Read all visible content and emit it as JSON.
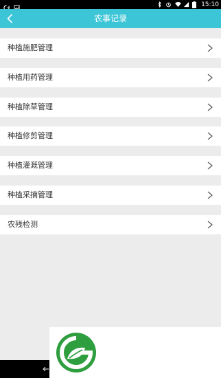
{
  "status_bar": {
    "time": "15:10"
  },
  "header": {
    "title": "农事记录",
    "color": "#3cc5d6"
  },
  "menu": {
    "items": [
      {
        "label": "种植施肥管理",
        "icon": "chevron-right-icon"
      },
      {
        "label": "种植用药管理",
        "icon": "chevron-right-icon"
      },
      {
        "label": "种植除草管理",
        "icon": "chevron-right-icon"
      },
      {
        "label": "种植修剪管理",
        "icon": "chevron-right-icon"
      },
      {
        "label": "种植灌溉管理",
        "icon": "chevron-right-icon"
      },
      {
        "label": "种植采摘管理",
        "icon": "chevron-right-icon"
      },
      {
        "label": "农残检测",
        "icon": "chevron-right-icon"
      }
    ]
  },
  "logo": {
    "icon": "leaf-g-logo-icon",
    "color": "#2e9e3e"
  }
}
